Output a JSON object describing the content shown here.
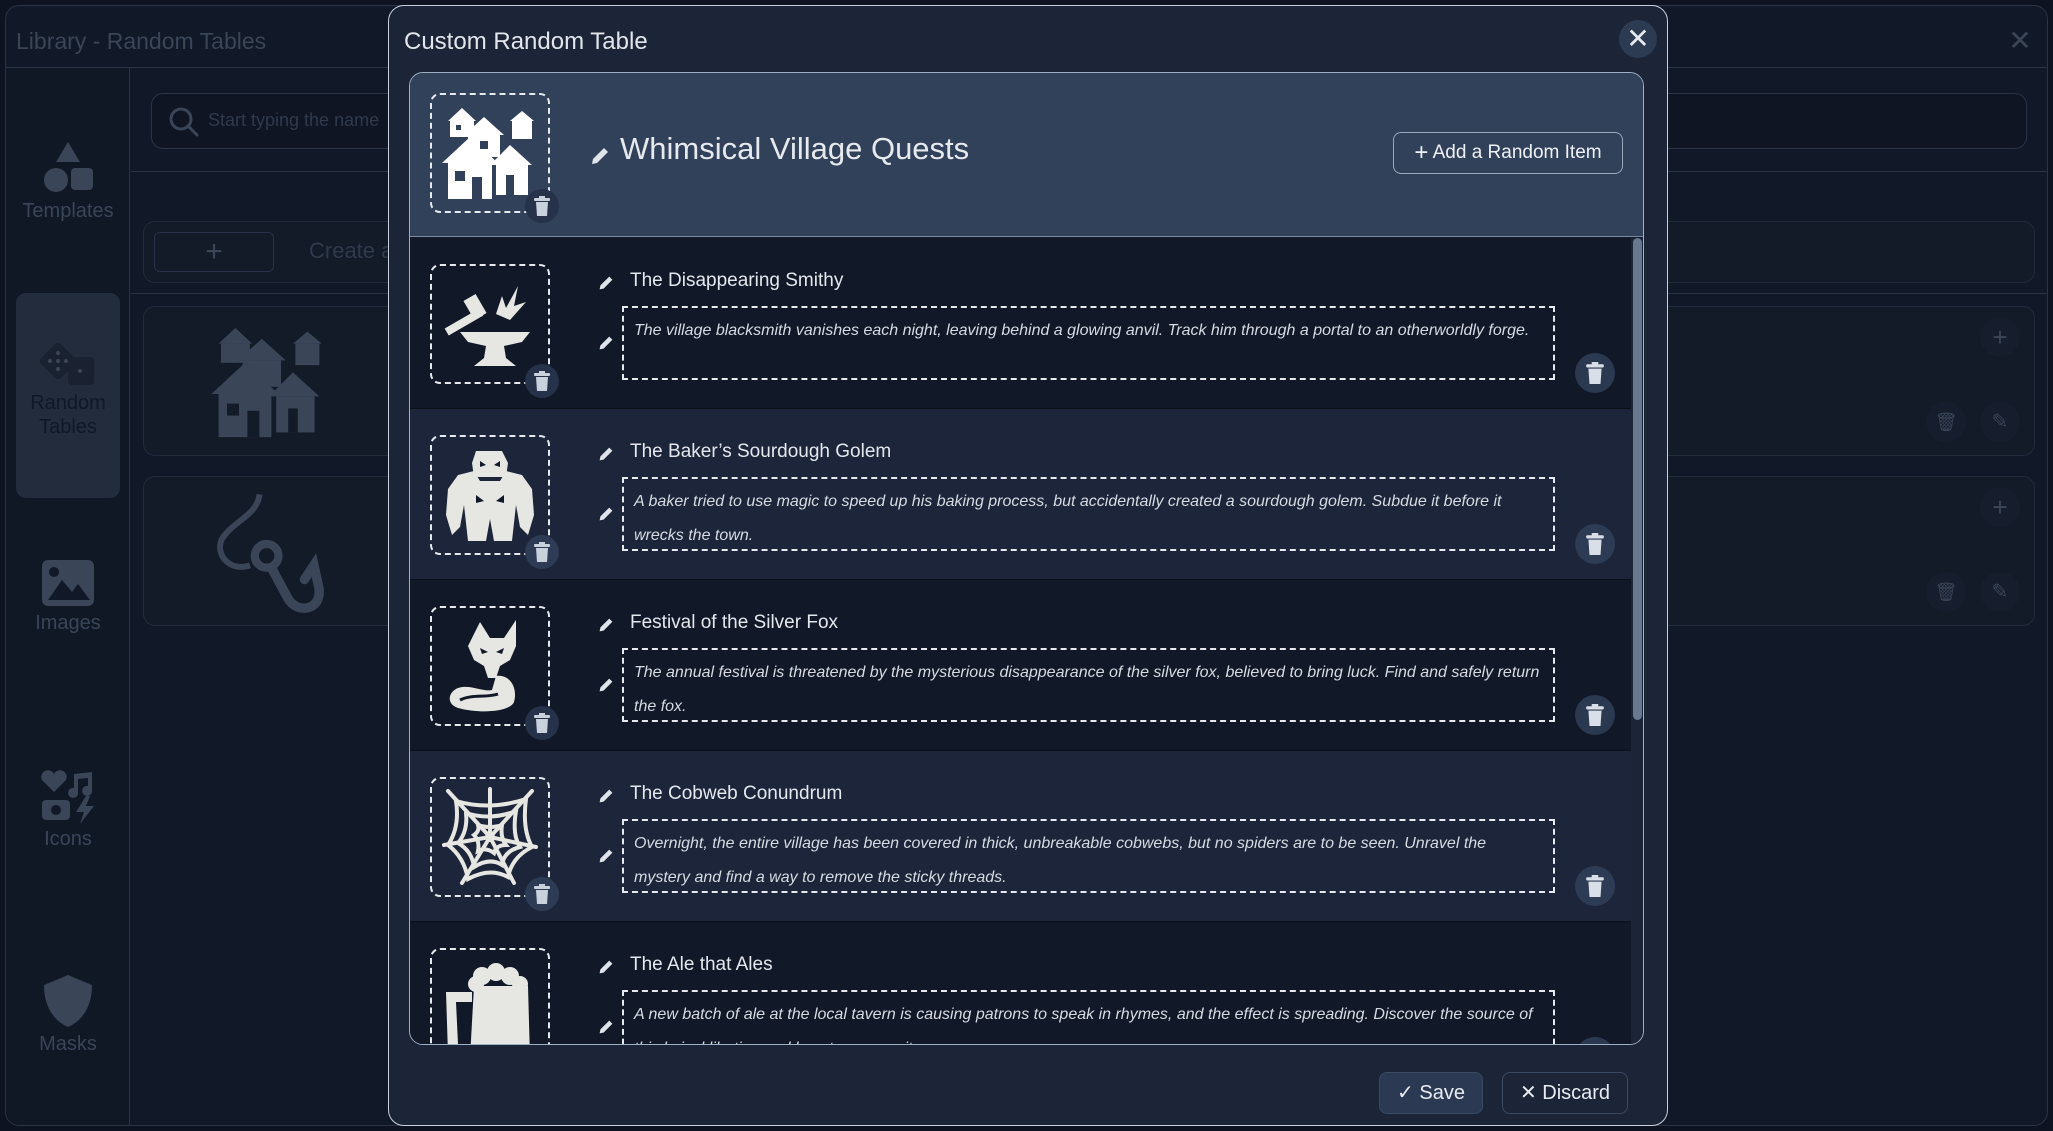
{
  "background_window": {
    "title": "Library - Random Tables",
    "close_icon": "close-icon",
    "search": {
      "placeholder": "Start typing the name",
      "icon": "search-icon"
    },
    "create_button": {
      "icon": "plus-icon",
      "label": "Create a R"
    },
    "sidebar": {
      "items": [
        {
          "label": "Templates",
          "icon": "shapes-icon",
          "active": false
        },
        {
          "label": "Random Tables",
          "icon": "dice-icon",
          "active": true
        },
        {
          "label": "Images",
          "icon": "image-icon",
          "active": false
        },
        {
          "label": "Icons",
          "icon": "icons-collection-icon",
          "active": false
        },
        {
          "label": "Masks",
          "icon": "shield-icon",
          "active": false
        }
      ]
    },
    "cards": [
      {
        "icon": "village-icon",
        "actions": [
          "plus-icon",
          "trash-icon",
          "pencil-icon"
        ]
      },
      {
        "icon": "fishing-hook-icon",
        "actions": [
          "plus-icon",
          "trash-icon",
          "pencil-icon"
        ]
      }
    ]
  },
  "modal": {
    "title": "Custom Random Table",
    "close_icon": "close-icon",
    "table": {
      "name": "Whimsical Village Quests",
      "icon": "village-icon",
      "add_item_label": "Add a Random Item"
    },
    "items": [
      {
        "title": "The Disappearing Smithy",
        "icon": "anvil-hammer-icon",
        "description": "The village blacksmith vanishes each night, leaving behind a glowing anvil. Track him through a portal to an otherworldly forge."
      },
      {
        "title": "The Baker’s Sourdough Golem",
        "icon": "golem-icon",
        "description": "A baker tried to use magic to speed up his baking process, but accidentally created a sourdough golem. Subdue it before it wrecks the town."
      },
      {
        "title": "Festival of the Silver Fox",
        "icon": "fox-icon",
        "description": "The annual festival is threatened by the mysterious disappearance of the silver fox, believed to bring luck. Find and safely return the fox."
      },
      {
        "title": "The Cobweb Conundrum",
        "icon": "spider-web-icon",
        "description": "Overnight, the entire village has been covered in thick, unbreakable cobwebs, but no spiders are to be seen. Unravel the mystery and find a way to remove the sticky threads."
      },
      {
        "title": "The Ale that Ales",
        "icon": "beer-mug-icon",
        "description": "A new batch of ale at the local tavern is causing patrons to speak in rhymes, and the effect is spreading. Discover the source of this lyrical libation and how to reverse it."
      }
    ],
    "footer": {
      "save_label": "Save",
      "discard_label": "Discard"
    }
  }
}
